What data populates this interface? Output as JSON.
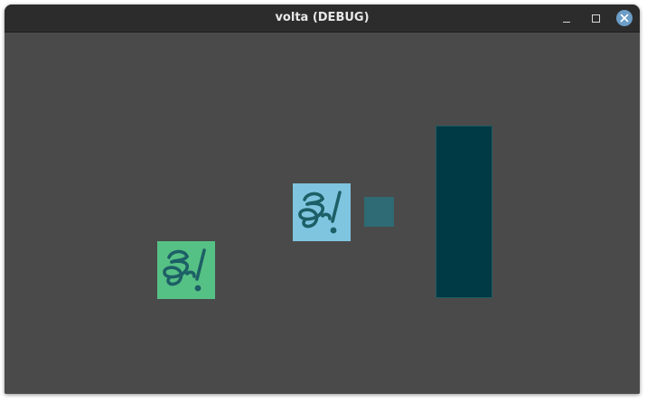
{
  "window": {
    "title": "volta (DEBUG)",
    "controls": {
      "minimize": "minimize-icon",
      "maximize": "maximize-icon",
      "close": "close-icon"
    }
  },
  "colors": {
    "titlebar": "#2c2c2c",
    "canvas_background": "#4a4a4a",
    "close_button": "#6b9dc7",
    "sprite_green": "#56c185",
    "sprite_blue": "#7fc5e0",
    "logo_glyph": "#1d5f66",
    "small_rect": "#2e6b74",
    "tall_rect": "#003a44"
  },
  "scene": {
    "sprites": [
      {
        "name": "green-logo-sprite",
        "icon": "volta-logo-icon"
      },
      {
        "name": "blue-logo-sprite",
        "icon": "volta-logo-icon"
      }
    ],
    "shapes": [
      {
        "name": "small-teal-rect"
      },
      {
        "name": "tall-dark-teal-rect"
      }
    ]
  }
}
